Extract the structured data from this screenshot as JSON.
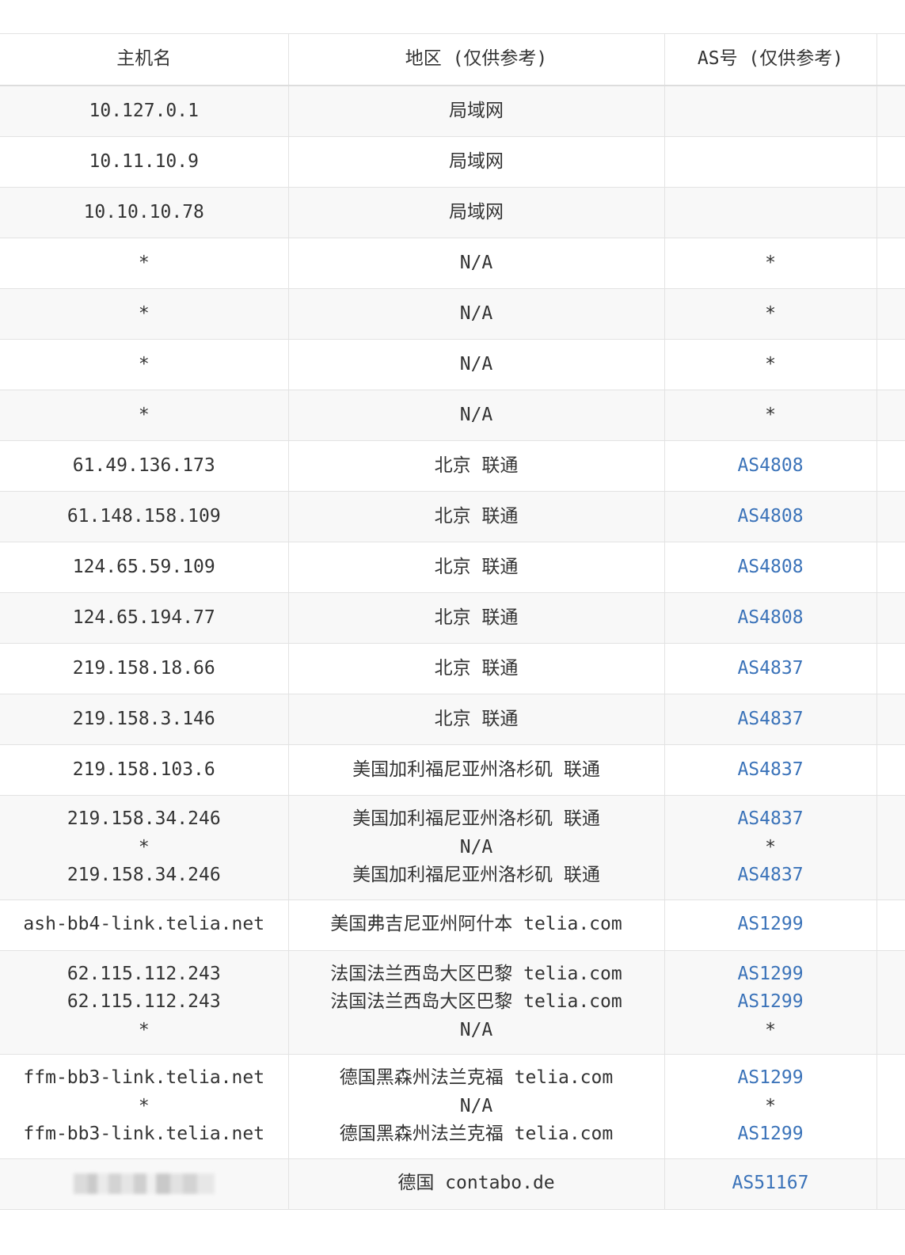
{
  "table": {
    "headers": {
      "hostname": "主机名",
      "region": "地区 (仅供参考)",
      "asn": "AS号 (仅供参考)"
    },
    "rows": [
      {
        "host": [
          "10.127.0.1"
        ],
        "region": [
          "局域网"
        ],
        "as": [
          ""
        ]
      },
      {
        "host": [
          "10.11.10.9"
        ],
        "region": [
          "局域网"
        ],
        "as": [
          ""
        ]
      },
      {
        "host": [
          "10.10.10.78"
        ],
        "region": [
          "局域网"
        ],
        "as": [
          ""
        ]
      },
      {
        "host": [
          "*"
        ],
        "region": [
          "N/A"
        ],
        "as": [
          "*"
        ]
      },
      {
        "host": [
          "*"
        ],
        "region": [
          "N/A"
        ],
        "as": [
          "*"
        ]
      },
      {
        "host": [
          "*"
        ],
        "region": [
          "N/A"
        ],
        "as": [
          "*"
        ]
      },
      {
        "host": [
          "*"
        ],
        "region": [
          "N/A"
        ],
        "as": [
          "*"
        ]
      },
      {
        "host": [
          "61.49.136.173"
        ],
        "region": [
          "北京 联通"
        ],
        "as": [
          "AS4808"
        ]
      },
      {
        "host": [
          "61.148.158.109"
        ],
        "region": [
          "北京 联通"
        ],
        "as": [
          "AS4808"
        ]
      },
      {
        "host": [
          "124.65.59.109"
        ],
        "region": [
          "北京 联通"
        ],
        "as": [
          "AS4808"
        ]
      },
      {
        "host": [
          "124.65.194.77"
        ],
        "region": [
          "北京 联通"
        ],
        "as": [
          "AS4808"
        ]
      },
      {
        "host": [
          "219.158.18.66"
        ],
        "region": [
          "北京 联通"
        ],
        "as": [
          "AS4837"
        ]
      },
      {
        "host": [
          "219.158.3.146"
        ],
        "region": [
          "北京 联通"
        ],
        "as": [
          "AS4837"
        ]
      },
      {
        "host": [
          "219.158.103.6"
        ],
        "region": [
          "美国加利福尼亚州洛杉矶 联通"
        ],
        "as": [
          "AS4837"
        ]
      },
      {
        "host": [
          "219.158.34.246",
          "*",
          "219.158.34.246"
        ],
        "region": [
          "美国加利福尼亚州洛杉矶 联通",
          "N/A",
          "美国加利福尼亚州洛杉矶 联通"
        ],
        "as": [
          "AS4837",
          "*",
          "AS4837"
        ]
      },
      {
        "host": [
          "ash-bb4-link.telia.net"
        ],
        "region": [
          "美国弗吉尼亚州阿什本 telia.com"
        ],
        "as": [
          "AS1299"
        ]
      },
      {
        "host": [
          "62.115.112.243",
          "62.115.112.243",
          "*"
        ],
        "region": [
          "法国法兰西岛大区巴黎 telia.com",
          "法国法兰西岛大区巴黎 telia.com",
          "N/A"
        ],
        "as": [
          "AS1299",
          "AS1299",
          "*"
        ]
      },
      {
        "host": [
          "ffm-bb3-link.telia.net",
          "*",
          "ffm-bb3-link.telia.net"
        ],
        "region": [
          "德国黑森州法兰克福 telia.com",
          "N/A",
          "德国黑森州法兰克福 telia.com"
        ],
        "as": [
          "AS1299",
          "*",
          "AS1299"
        ]
      },
      {
        "host": [
          ""
        ],
        "host_redacted": true,
        "region": [
          "德国 contabo.de"
        ],
        "as": [
          "AS51167"
        ]
      }
    ]
  },
  "colors": {
    "text": "#333333",
    "link": "#3b73b9",
    "border": "#e3e3e3",
    "stripe": "#f8f8f8"
  }
}
